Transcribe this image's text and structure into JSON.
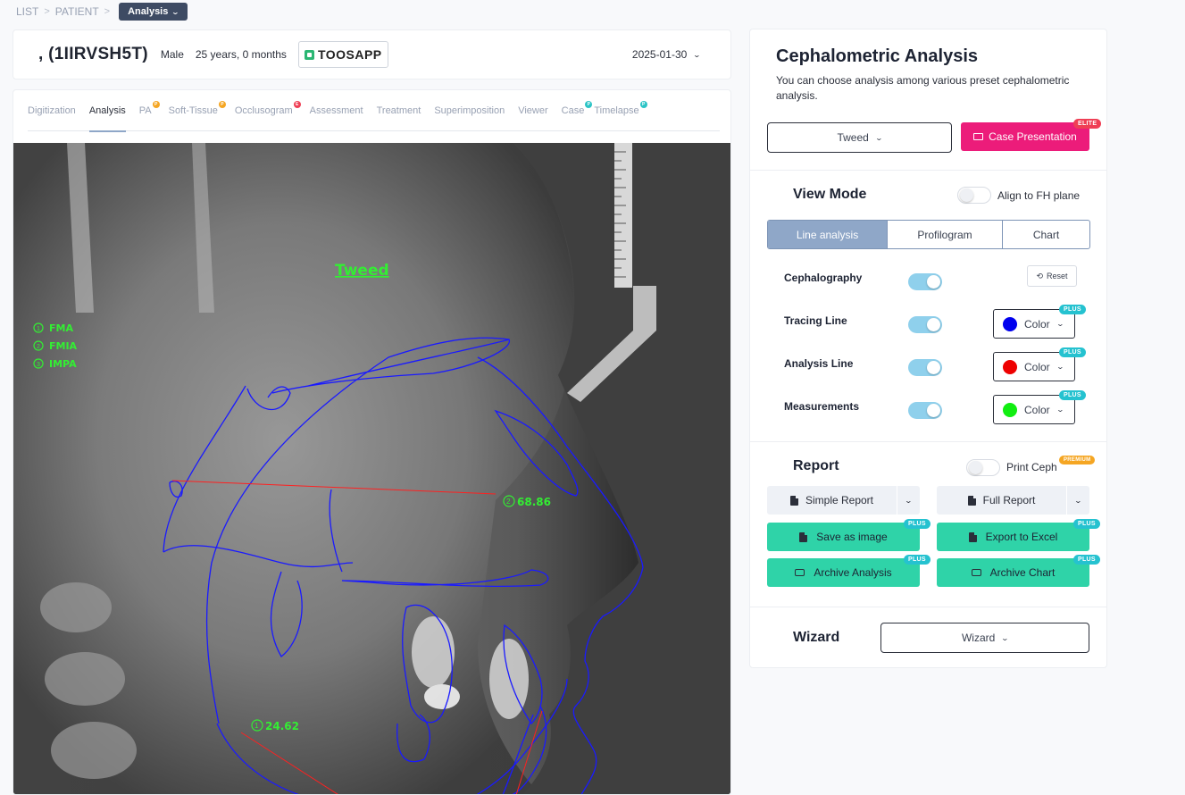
{
  "breadcrumb": {
    "items": [
      "LIST",
      "PATIENT"
    ],
    "active": "Analysis",
    "separator": ">"
  },
  "patient": {
    "name": ", (1IIRVSH5T)",
    "sex": "Male",
    "age": "25 years, 0 months",
    "brand": "TOOSAPP",
    "date": "2025-01-30"
  },
  "tabs": [
    {
      "label": "Digitization",
      "active": false,
      "badge": ""
    },
    {
      "label": "Analysis",
      "active": true,
      "badge": ""
    },
    {
      "label": "PA",
      "active": false,
      "badge": "P"
    },
    {
      "label": "Soft-Tissue",
      "active": false,
      "badge": "P"
    },
    {
      "label": "Occlusogram",
      "active": false,
      "badge": "E"
    },
    {
      "label": "Assessment",
      "active": false,
      "badge": ""
    },
    {
      "label": "Treatment",
      "active": false,
      "badge": ""
    },
    {
      "label": "Superimposition",
      "active": false,
      "badge": ""
    },
    {
      "label": "Viewer",
      "active": false,
      "badge": ""
    },
    {
      "label": "Case",
      "active": false,
      "badge": "P"
    },
    {
      "label": "Timelapse",
      "active": false,
      "badge": "P"
    }
  ],
  "xray": {
    "analysis_title": "Tweed",
    "legend": [
      {
        "num": "1",
        "label": "FMA"
      },
      {
        "num": "2",
        "label": "FMIA"
      },
      {
        "num": "3",
        "label": "IMPA"
      }
    ],
    "measurements": [
      {
        "num": "2",
        "value": "68.86"
      },
      {
        "num": "1",
        "value": "24.62"
      }
    ],
    "colors": {
      "tracing": "#1a1aff",
      "analysis": "#ff2020",
      "measurement": "#33ee33"
    }
  },
  "panel": {
    "title": "Cephalometric Analysis",
    "subtitle": "You can choose analysis among various preset cephalometric analysis.",
    "analysis_select": "Tweed",
    "case_presentation": "Case Presentation",
    "elite_badge": "ELITE",
    "view_mode": {
      "title": "View Mode",
      "align_label": "Align to FH plane",
      "align_on": false,
      "modes": [
        "Line analysis",
        "Profilogram",
        "Chart"
      ],
      "active_mode": "Line analysis"
    },
    "layers": {
      "reset": "Reset",
      "rows": [
        {
          "label": "Cephalography",
          "on": true,
          "color": null
        },
        {
          "label": "Tracing Line",
          "on": true,
          "color": "#0000ee",
          "color_label": "Color",
          "badge": "PLUS"
        },
        {
          "label": "Analysis Line",
          "on": true,
          "color": "#ee0000",
          "color_label": "Color",
          "badge": "PLUS"
        },
        {
          "label": "Measurements",
          "on": true,
          "color": "#11ee11",
          "color_label": "Color",
          "badge": "PLUS"
        }
      ]
    },
    "report": {
      "title": "Report",
      "print_label": "Print Ceph",
      "print_on": false,
      "premium_badge": "PREMIUM",
      "simple_report": "Simple Report",
      "full_report": "Full Report",
      "save_image": "Save as image",
      "export_excel": "Export to Excel",
      "archive_analysis": "Archive Analysis",
      "archive_chart": "Archive Chart",
      "plus_badge": "PLUS"
    },
    "wizard": {
      "title": "Wizard",
      "select": "Wizard"
    }
  }
}
